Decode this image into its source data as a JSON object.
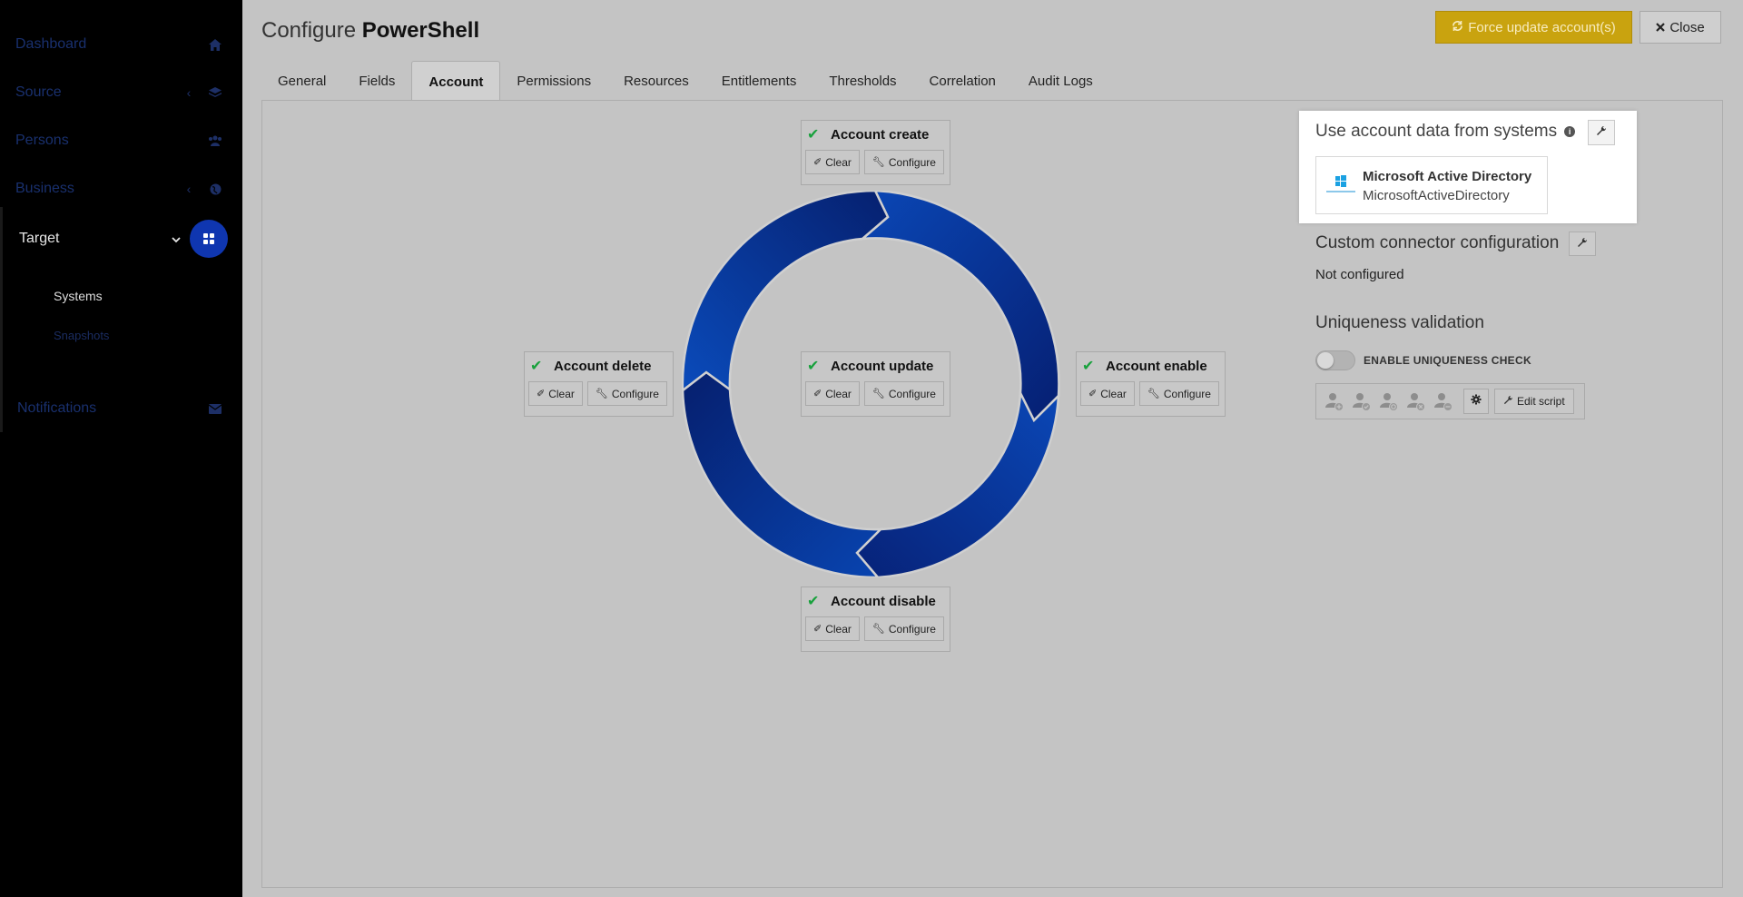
{
  "sidebar": {
    "items": [
      {
        "label": "Dashboard",
        "icon": "home-icon"
      },
      {
        "label": "Source",
        "icon": "layers-icon"
      },
      {
        "label": "Persons",
        "icon": "users-icon"
      },
      {
        "label": "Business",
        "icon": "globe-icon"
      },
      {
        "label": "Target",
        "icon": "grid-icon"
      },
      {
        "label": "Notifications",
        "icon": "envelope-icon"
      }
    ],
    "subitems": [
      {
        "label": "Systems"
      },
      {
        "label": "Snapshots"
      }
    ]
  },
  "header": {
    "title_prefix": "Configure",
    "title_name": "PowerShell",
    "force_update_label": "Force update account(s)",
    "close_label": "Close"
  },
  "tabs": [
    {
      "label": "General"
    },
    {
      "label": "Fields"
    },
    {
      "label": "Account",
      "active": true
    },
    {
      "label": "Permissions"
    },
    {
      "label": "Resources"
    },
    {
      "label": "Entitlements"
    },
    {
      "label": "Thresholds"
    },
    {
      "label": "Correlation"
    },
    {
      "label": "Audit Logs"
    }
  ],
  "steps": {
    "create": {
      "title": "Account create",
      "clear": "Clear",
      "configure": "Configure"
    },
    "update": {
      "title": "Account update",
      "clear": "Clear",
      "configure": "Configure"
    },
    "delete": {
      "title": "Account delete",
      "clear": "Clear",
      "configure": "Configure"
    },
    "enable": {
      "title": "Account enable",
      "clear": "Clear",
      "configure": "Configure"
    },
    "disable": {
      "title": "Account disable",
      "clear": "Clear",
      "configure": "Configure"
    }
  },
  "account_data": {
    "title": "Use account data from systems",
    "system_name": "Microsoft Active Directory",
    "system_id": "MicrosoftActiveDirectory"
  },
  "custom_connector": {
    "title": "Custom connector configuration",
    "status": "Not configured"
  },
  "uniqueness": {
    "title": "Uniqueness validation",
    "toggle_label": "ENABLE UNIQUENESS CHECK",
    "enabled": false,
    "edit_script_label": "Edit script"
  },
  "colors": {
    "accent": "#0f36b0",
    "force_button": "#c9a30f",
    "check": "#18a13c",
    "cycle_light": "#0a49b8",
    "cycle_dark": "#061e6e"
  }
}
